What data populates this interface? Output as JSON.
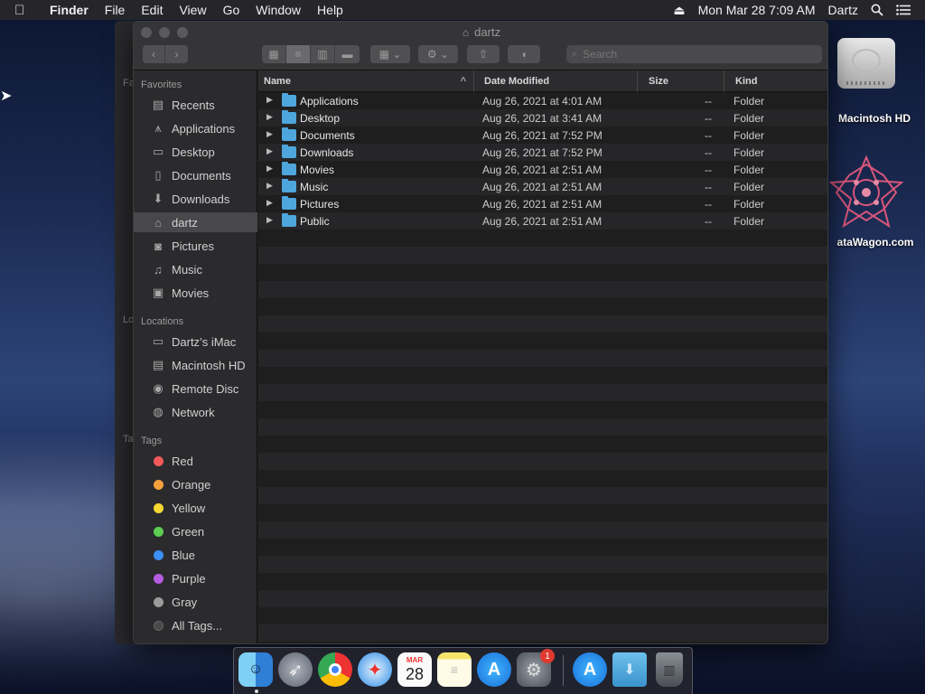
{
  "menubar": {
    "app_name": "Finder",
    "items": [
      "File",
      "Edit",
      "View",
      "Go",
      "Window",
      "Help"
    ],
    "clock": "Mon Mar 28  7:09 AM",
    "user": "Dartz"
  },
  "window": {
    "title": "dartz",
    "search_placeholder": "Search"
  },
  "background_window": {
    "label_favorites": "Fa",
    "label_locations": "Lo",
    "label_tags": "Ta"
  },
  "sidebar": {
    "favorites_heading": "Favorites",
    "favorites": [
      {
        "label": "Recents",
        "icon": "clock-icon"
      },
      {
        "label": "Applications",
        "icon": "applications-icon"
      },
      {
        "label": "Desktop",
        "icon": "desktop-icon"
      },
      {
        "label": "Documents",
        "icon": "document-icon"
      },
      {
        "label": "Downloads",
        "icon": "download-icon"
      },
      {
        "label": "dartz",
        "icon": "home-icon",
        "selected": true
      },
      {
        "label": "Pictures",
        "icon": "camera-icon"
      },
      {
        "label": "Music",
        "icon": "music-note-icon"
      },
      {
        "label": "Movies",
        "icon": "film-icon"
      }
    ],
    "locations_heading": "Locations",
    "locations": [
      {
        "label": "Dartz’s iMac",
        "icon": "imac-icon"
      },
      {
        "label": "Macintosh HD",
        "icon": "hard-drive-icon"
      },
      {
        "label": "Remote Disc",
        "icon": "disc-icon"
      },
      {
        "label": "Network",
        "icon": "globe-icon"
      }
    ],
    "tags_heading": "Tags",
    "tags": [
      {
        "label": "Red",
        "color": "#f25a5a"
      },
      {
        "label": "Orange",
        "color": "#f4a13b"
      },
      {
        "label": "Yellow",
        "color": "#f5d733"
      },
      {
        "label": "Green",
        "color": "#5ccd52"
      },
      {
        "label": "Blue",
        "color": "#3d8ff5"
      },
      {
        "label": "Purple",
        "color": "#b65ce0"
      },
      {
        "label": "Gray",
        "color": "#9b9b9b"
      },
      {
        "label": "All Tags...",
        "color": "#4a4a4a"
      }
    ]
  },
  "columns": {
    "name": "Name",
    "date_modified": "Date Modified",
    "size": "Size",
    "kind": "Kind"
  },
  "files": [
    {
      "name": "Applications",
      "date": "Aug 26, 2021 at 4:01 AM",
      "size": "--",
      "kind": "Folder"
    },
    {
      "name": "Desktop",
      "date": "Aug 26, 2021 at 3:41 AM",
      "size": "--",
      "kind": "Folder"
    },
    {
      "name": "Documents",
      "date": "Aug 26, 2021 at 7:52 PM",
      "size": "--",
      "kind": "Folder"
    },
    {
      "name": "Downloads",
      "date": "Aug 26, 2021 at 7:52 PM",
      "size": "--",
      "kind": "Folder"
    },
    {
      "name": "Movies",
      "date": "Aug 26, 2021 at 2:51 AM",
      "size": "--",
      "kind": "Folder"
    },
    {
      "name": "Music",
      "date": "Aug 26, 2021 at 2:51 AM",
      "size": "--",
      "kind": "Folder"
    },
    {
      "name": "Pictures",
      "date": "Aug 26, 2021 at 2:51 AM",
      "size": "--",
      "kind": "Folder"
    },
    {
      "name": "Public",
      "date": "Aug 26, 2021 at 2:51 AM",
      "size": "--",
      "kind": "Folder"
    }
  ],
  "desktop": {
    "hd_label": "Macintosh HD",
    "logo_label": "ataWagon.com"
  },
  "dock": {
    "calendar_month": "MAR",
    "calendar_day": "28",
    "settings_badge": "1"
  }
}
